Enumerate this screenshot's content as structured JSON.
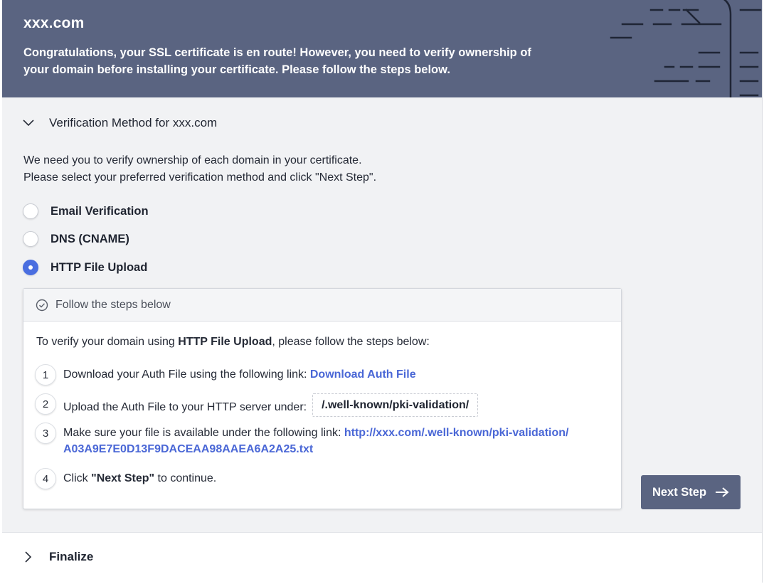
{
  "header": {
    "domain": "xxx.com",
    "message": "Congratulations, your SSL certificate is en route! However, you need to verify ownership of your domain before installing your certificate. Please follow the steps below."
  },
  "verification_section": {
    "title": "Verification Method for xxx.com",
    "expanded": true,
    "chevron_icon": "chevron-down-icon",
    "intro_line1": "We need you to verify ownership of each domain in your certificate.",
    "intro_line2": "Please select your preferred verification method and click \"Next Step\".",
    "methods": [
      {
        "label": "Email Verification",
        "selected": false
      },
      {
        "label": "DNS (CNAME)",
        "selected": false
      },
      {
        "label": "HTTP File Upload",
        "selected": true
      }
    ]
  },
  "steps_card": {
    "header_icon": "check-circle-icon",
    "header_title": "Follow the steps below",
    "lead_prefix": "To verify your domain using ",
    "lead_method": "HTTP File Upload",
    "lead_suffix": ", please follow the steps below:",
    "steps": [
      {
        "number": "1",
        "text": "Download your Auth File using the following link: ",
        "link": "Download Auth File"
      },
      {
        "number": "2",
        "text": "Upload the Auth File to your HTTP server under:",
        "path": "/.well-known/pki-validation/"
      },
      {
        "number": "3",
        "text": "Make sure your file is available under the following link: ",
        "link": "http://xxx.com/.well-known/pki-validation/A03A9E7E0D13F9DACEAA98AAEA6A2A25.txt"
      },
      {
        "number": "4",
        "text_prefix": "Click ",
        "bold": "\"Next Step\"",
        "text_suffix": " to continue."
      }
    ]
  },
  "next_button": {
    "label": "Next Step",
    "icon": "arrow-right-icon"
  },
  "finalize_section": {
    "title": "Finalize",
    "expanded": false,
    "chevron_icon": "chevron-right-icon"
  },
  "colors": {
    "header_bg": "#5a6481",
    "accent_blue": "#4a6ee0",
    "link_blue": "#4a67d6",
    "page_bg": "#f1f2f4"
  }
}
